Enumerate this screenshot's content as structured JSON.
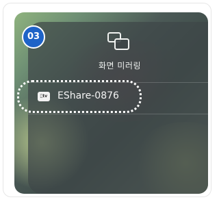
{
  "step_badge": {
    "number": "03",
    "color": "#1e63c7"
  },
  "screen_mirroring": {
    "title": "화면 미러링",
    "icon": "screen-mirroring-icon",
    "devices": [
      {
        "icon": "appletv-icon",
        "icon_text": "tv",
        "name": "EShare-0876",
        "highlighted": true
      }
    ]
  }
}
